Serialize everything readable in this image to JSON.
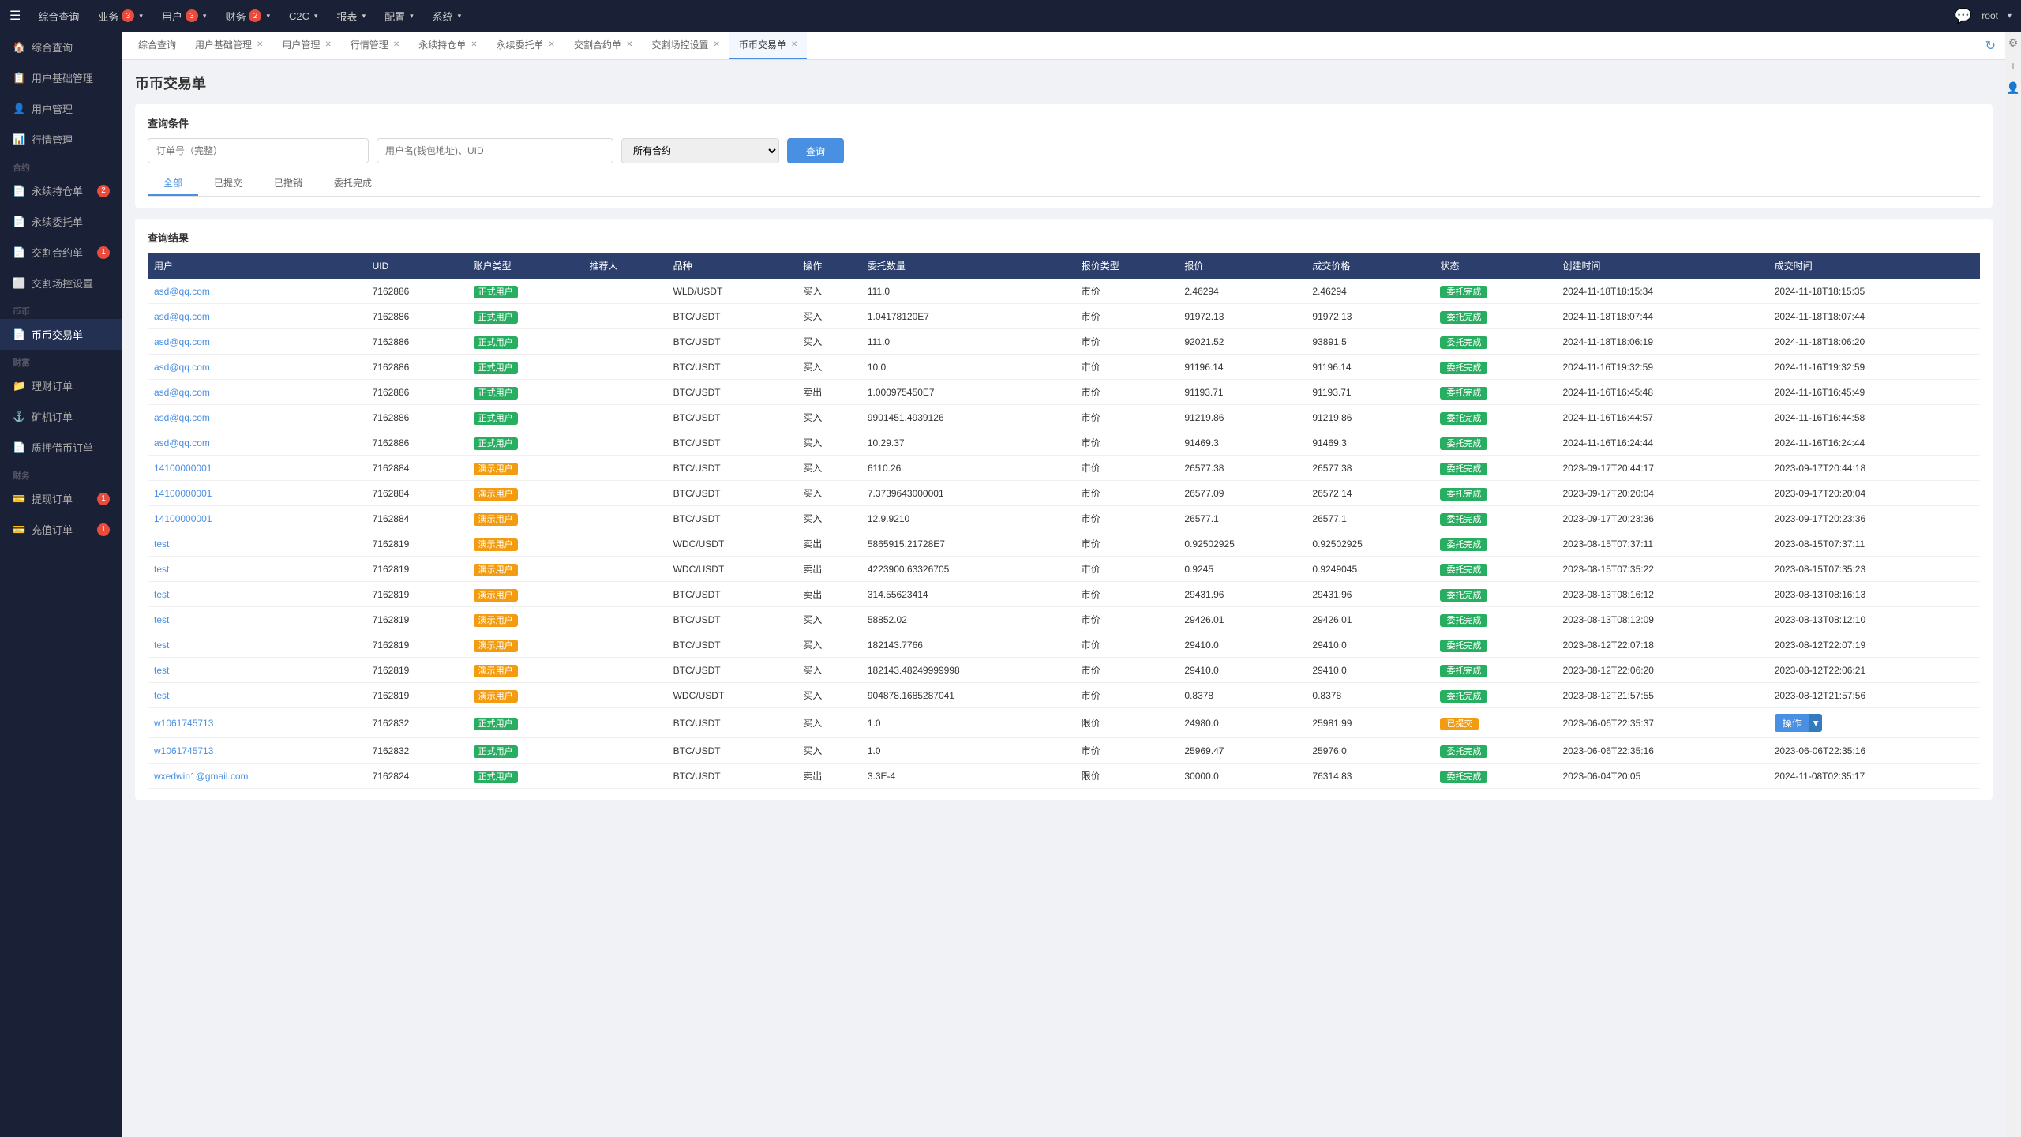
{
  "topNav": {
    "menuIcon": "☰",
    "items": [
      {
        "label": "综合查询",
        "badge": null,
        "hasArrow": false
      },
      {
        "label": "业务",
        "badge": "3",
        "hasArrow": true
      },
      {
        "label": "用户",
        "badge": "3",
        "hasArrow": true
      },
      {
        "label": "财务",
        "badge": "2",
        "hasArrow": true
      },
      {
        "label": "C2C",
        "badge": null,
        "hasArrow": true
      },
      {
        "label": "报表",
        "badge": null,
        "hasArrow": true
      },
      {
        "label": "配置",
        "badge": null,
        "hasArrow": true
      },
      {
        "label": "系统",
        "badge": null,
        "hasArrow": true
      }
    ],
    "chatIcon": "💬",
    "userLabel": "root",
    "userArrow": "▾"
  },
  "sidebar": {
    "topItems": [
      {
        "label": "综合查询",
        "icon": "🏠",
        "active": false,
        "badge": null
      },
      {
        "label": "用户基础管理",
        "icon": "📋",
        "active": false,
        "badge": null
      },
      {
        "label": "用户管理",
        "icon": "👤",
        "active": false,
        "badge": null
      },
      {
        "label": "行情管理",
        "icon": "📊",
        "active": false,
        "badge": null
      }
    ],
    "contractGroup": "合约",
    "contractItems": [
      {
        "label": "永续持仓单",
        "icon": "📄",
        "active": false,
        "badge": "2"
      },
      {
        "label": "永续委托单",
        "icon": "📄",
        "active": false,
        "badge": null
      },
      {
        "label": "交割合约单",
        "icon": "📄",
        "active": false,
        "badge": "1"
      },
      {
        "label": "交割场控设置",
        "icon": "⬜",
        "active": false,
        "badge": null
      }
    ],
    "coinGroup": "币币",
    "coinItems": [
      {
        "label": "币币交易单",
        "icon": "📄",
        "active": true,
        "badge": null
      }
    ],
    "wealthGroup": "财富",
    "wealthItems": [
      {
        "label": "理财订单",
        "icon": "📁",
        "active": false,
        "badge": null
      },
      {
        "label": "矿机订单",
        "icon": "⚓",
        "active": false,
        "badge": null
      },
      {
        "label": "质押借币订单",
        "icon": "📄",
        "active": false,
        "badge": null
      }
    ],
    "financeGroup": "财务",
    "financeItems": [
      {
        "label": "提现订单",
        "icon": "💳",
        "active": false,
        "badge": "1"
      },
      {
        "label": "充值订单",
        "icon": "💳",
        "active": false,
        "badge": "1"
      }
    ]
  },
  "tabs": [
    {
      "label": "综合查询",
      "closable": false,
      "active": false
    },
    {
      "label": "用户基础管理",
      "closable": true,
      "active": false
    },
    {
      "label": "用户管理",
      "closable": true,
      "active": false
    },
    {
      "label": "行情管理",
      "closable": true,
      "active": false
    },
    {
      "label": "永续持仓单",
      "closable": true,
      "active": false
    },
    {
      "label": "永续委托单",
      "closable": true,
      "active": false
    },
    {
      "label": "交割合约单",
      "closable": true,
      "active": false
    },
    {
      "label": "交割场控设置",
      "closable": true,
      "active": false
    },
    {
      "label": "币币交易单",
      "closable": true,
      "active": true
    }
  ],
  "page": {
    "title": "币币交易单",
    "searchTitle": "查询条件",
    "orderNoPlaceholder": "订单号（完整）",
    "userPlaceholder": "用户名(钱包地址)、UID",
    "contractDefault": "所有合约",
    "searchBtnLabel": "查询",
    "filterTabs": [
      "全部",
      "已提交",
      "已撤销",
      "委托完成"
    ],
    "activeFilter": "全部",
    "resultsTitle": "查询结果"
  },
  "tableHeaders": [
    "用户",
    "UID",
    "账户类型",
    "推荐人",
    "品种",
    "操作",
    "委托数量",
    "报价类型",
    "报价",
    "成交价格",
    "状态",
    "创建时间",
    "成交时间"
  ],
  "tableRows": [
    {
      "user": "asd@qq.com",
      "uid": "7162886",
      "accountType": "正式用户",
      "accountTypeColor": "green",
      "referrer": "",
      "product": "WLD/USDT",
      "operation": "买入",
      "quantity": "111.0",
      "priceType": "市价",
      "price": "2.46294",
      "dealPrice": "2.46294",
      "status": "委托完成",
      "statusColor": "green",
      "createTime": "2024-11-18T18:15:34",
      "dealTime": "2024-11-18T18:15:35"
    },
    {
      "user": "asd@qq.com",
      "uid": "7162886",
      "accountType": "正式用户",
      "accountTypeColor": "green",
      "referrer": "",
      "product": "BTC/USDT",
      "operation": "买入",
      "quantity": "1.04178120E7",
      "priceType": "市价",
      "price": "91972.13",
      "dealPrice": "91972.13",
      "status": "委托完成",
      "statusColor": "green",
      "createTime": "2024-11-18T18:07:44",
      "dealTime": "2024-11-18T18:07:44"
    },
    {
      "user": "asd@qq.com",
      "uid": "7162886",
      "accountType": "正式用户",
      "accountTypeColor": "green",
      "referrer": "",
      "product": "BTC/USDT",
      "operation": "买入",
      "quantity": "111.0",
      "priceType": "市价",
      "price": "92021.52",
      "dealPrice": "93891.5",
      "status": "委托完成",
      "statusColor": "green",
      "createTime": "2024-11-18T18:06:19",
      "dealTime": "2024-11-18T18:06:20"
    },
    {
      "user": "asd@qq.com",
      "uid": "7162886",
      "accountType": "正式用户",
      "accountTypeColor": "green",
      "referrer": "",
      "product": "BTC/USDT",
      "operation": "买入",
      "quantity": "10.0",
      "priceType": "市价",
      "price": "91196.14",
      "dealPrice": "91196.14",
      "status": "委托完成",
      "statusColor": "green",
      "createTime": "2024-11-16T19:32:59",
      "dealTime": "2024-11-16T19:32:59"
    },
    {
      "user": "asd@qq.com",
      "uid": "7162886",
      "accountType": "正式用户",
      "accountTypeColor": "green",
      "referrer": "",
      "product": "BTC/USDT",
      "operation": "卖出",
      "quantity": "1.000975450E7",
      "priceType": "市价",
      "price": "91193.71",
      "dealPrice": "91193.71",
      "status": "委托完成",
      "statusColor": "green",
      "createTime": "2024-11-16T16:45:48",
      "dealTime": "2024-11-16T16:45:49"
    },
    {
      "user": "asd@qq.com",
      "uid": "7162886",
      "accountType": "正式用户",
      "accountTypeColor": "green",
      "referrer": "",
      "product": "BTC/USDT",
      "operation": "买入",
      "quantity": "9901451.4939126",
      "priceType": "市价",
      "price": "91219.86",
      "dealPrice": "91219.86",
      "status": "委托完成",
      "statusColor": "green",
      "createTime": "2024-11-16T16:44:57",
      "dealTime": "2024-11-16T16:44:58"
    },
    {
      "user": "asd@qq.com",
      "uid": "7162886",
      "accountType": "正式用户",
      "accountTypeColor": "green",
      "referrer": "",
      "product": "BTC/USDT",
      "operation": "买入",
      "quantity": "10.29.37",
      "priceType": "市价",
      "price": "91469.3",
      "dealPrice": "91469.3",
      "status": "委托完成",
      "statusColor": "green",
      "createTime": "2024-11-16T16:24:44",
      "dealTime": "2024-11-16T16:24:44"
    },
    {
      "user": "14100000001",
      "uid": "7162884",
      "accountType": "演示用户",
      "accountTypeColor": "orange",
      "referrer": "",
      "product": "BTC/USDT",
      "operation": "买入",
      "quantity": "6110.26",
      "priceType": "市价",
      "price": "26577.38",
      "dealPrice": "26577.38",
      "status": "委托完成",
      "statusColor": "green",
      "createTime": "2023-09-17T20:44:17",
      "dealTime": "2023-09-17T20:44:18"
    },
    {
      "user": "14100000001",
      "uid": "7162884",
      "accountType": "演示用户",
      "accountTypeColor": "orange",
      "referrer": "",
      "product": "BTC/USDT",
      "operation": "买入",
      "quantity": "7.3739643000001",
      "priceType": "市价",
      "price": "26577.09",
      "dealPrice": "26572.14",
      "status": "委托完成",
      "statusColor": "green",
      "createTime": "2023-09-17T20:20:04",
      "dealTime": "2023-09-17T20:20:04"
    },
    {
      "user": "14100000001",
      "uid": "7162884",
      "accountType": "演示用户",
      "accountTypeColor": "orange",
      "referrer": "",
      "product": "BTC/USDT",
      "operation": "买入",
      "quantity": "12.9.9210",
      "priceType": "市价",
      "price": "26577.1",
      "dealPrice": "26577.1",
      "status": "委托完成",
      "statusColor": "green",
      "createTime": "2023-09-17T20:23:36",
      "dealTime": "2023-09-17T20:23:36"
    },
    {
      "user": "test",
      "uid": "7162819",
      "accountType": "演示用户",
      "accountTypeColor": "orange",
      "referrer": "",
      "product": "WDC/USDT",
      "operation": "卖出",
      "quantity": "5865915.21728E7",
      "priceType": "市价",
      "price": "0.92502925",
      "dealPrice": "0.92502925",
      "status": "委托完成",
      "statusColor": "green",
      "createTime": "2023-08-15T07:37:11",
      "dealTime": "2023-08-15T07:37:11"
    },
    {
      "user": "test",
      "uid": "7162819",
      "accountType": "演示用户",
      "accountTypeColor": "orange",
      "referrer": "",
      "product": "WDC/USDT",
      "operation": "卖出",
      "quantity": "4223900.63326705",
      "priceType": "市价",
      "price": "0.9245",
      "dealPrice": "0.9249045",
      "status": "委托完成",
      "statusColor": "green",
      "createTime": "2023-08-15T07:35:22",
      "dealTime": "2023-08-15T07:35:23"
    },
    {
      "user": "test",
      "uid": "7162819",
      "accountType": "演示用户",
      "accountTypeColor": "orange",
      "referrer": "",
      "product": "BTC/USDT",
      "operation": "卖出",
      "quantity": "314.55623414",
      "priceType": "市价",
      "price": "29431.96",
      "dealPrice": "29431.96",
      "status": "委托完成",
      "statusColor": "green",
      "createTime": "2023-08-13T08:16:12",
      "dealTime": "2023-08-13T08:16:13"
    },
    {
      "user": "test",
      "uid": "7162819",
      "accountType": "演示用户",
      "accountTypeColor": "orange",
      "referrer": "",
      "product": "BTC/USDT",
      "operation": "买入",
      "quantity": "58852.02",
      "priceType": "市价",
      "price": "29426.01",
      "dealPrice": "29426.01",
      "status": "委托完成",
      "statusColor": "green",
      "createTime": "2023-08-13T08:12:09",
      "dealTime": "2023-08-13T08:12:10"
    },
    {
      "user": "test",
      "uid": "7162819",
      "accountType": "演示用户",
      "accountTypeColor": "orange",
      "referrer": "",
      "product": "BTC/USDT",
      "operation": "买入",
      "quantity": "182143.7766",
      "priceType": "市价",
      "price": "29410.0",
      "dealPrice": "29410.0",
      "status": "委托完成",
      "statusColor": "green",
      "createTime": "2023-08-12T22:07:18",
      "dealTime": "2023-08-12T22:07:19"
    },
    {
      "user": "test",
      "uid": "7162819",
      "accountType": "演示用户",
      "accountTypeColor": "orange",
      "referrer": "",
      "product": "BTC/USDT",
      "operation": "买入",
      "quantity": "182143.48249999998",
      "priceType": "市价",
      "price": "29410.0",
      "dealPrice": "29410.0",
      "status": "委托完成",
      "statusColor": "green",
      "createTime": "2023-08-12T22:06:20",
      "dealTime": "2023-08-12T22:06:21"
    },
    {
      "user": "test",
      "uid": "7162819",
      "accountType": "演示用户",
      "accountTypeColor": "orange",
      "referrer": "",
      "product": "WDC/USDT",
      "operation": "买入",
      "quantity": "904878.1685287041",
      "priceType": "市价",
      "price": "0.8378",
      "dealPrice": "0.8378",
      "status": "委托完成",
      "statusColor": "green",
      "createTime": "2023-08-12T21:57:55",
      "dealTime": "2023-08-12T21:57:56"
    },
    {
      "user": "w1061745713",
      "uid": "7162832",
      "accountType": "正式用户",
      "accountTypeColor": "green",
      "referrer": "",
      "product": "BTC/USDT",
      "operation": "买入",
      "quantity": "1.0",
      "priceType": "限价",
      "price": "24980.0",
      "dealPrice": "25981.99",
      "status": "已提交",
      "statusColor": "yellow",
      "createTime": "2023-06-06T22:35:37",
      "dealTime": "",
      "hasOp": true
    },
    {
      "user": "w1061745713",
      "uid": "7162832",
      "accountType": "正式用户",
      "accountTypeColor": "green",
      "referrer": "",
      "product": "BTC/USDT",
      "operation": "买入",
      "quantity": "1.0",
      "priceType": "市价",
      "price": "25969.47",
      "dealPrice": "25976.0",
      "status": "委托完成",
      "statusColor": "green",
      "createTime": "2023-06-06T22:35:16",
      "dealTime": "2023-06-06T22:35:16"
    },
    {
      "user": "wxedwin1@gmail.com",
      "uid": "7162824",
      "accountType": "正式用户",
      "accountTypeColor": "green",
      "referrer": "",
      "product": "BTC/USDT",
      "operation": "卖出",
      "quantity": "3.3E-4",
      "priceType": "限价",
      "price": "30000.0",
      "dealPrice": "76314.83",
      "status": "委托完成",
      "statusColor": "green",
      "createTime": "2023-06-04T20:05",
      "dealTime": "2024-11-08T02:35:17"
    }
  ],
  "operationBtn": {
    "label": "操作",
    "arrowLabel": "▾"
  }
}
